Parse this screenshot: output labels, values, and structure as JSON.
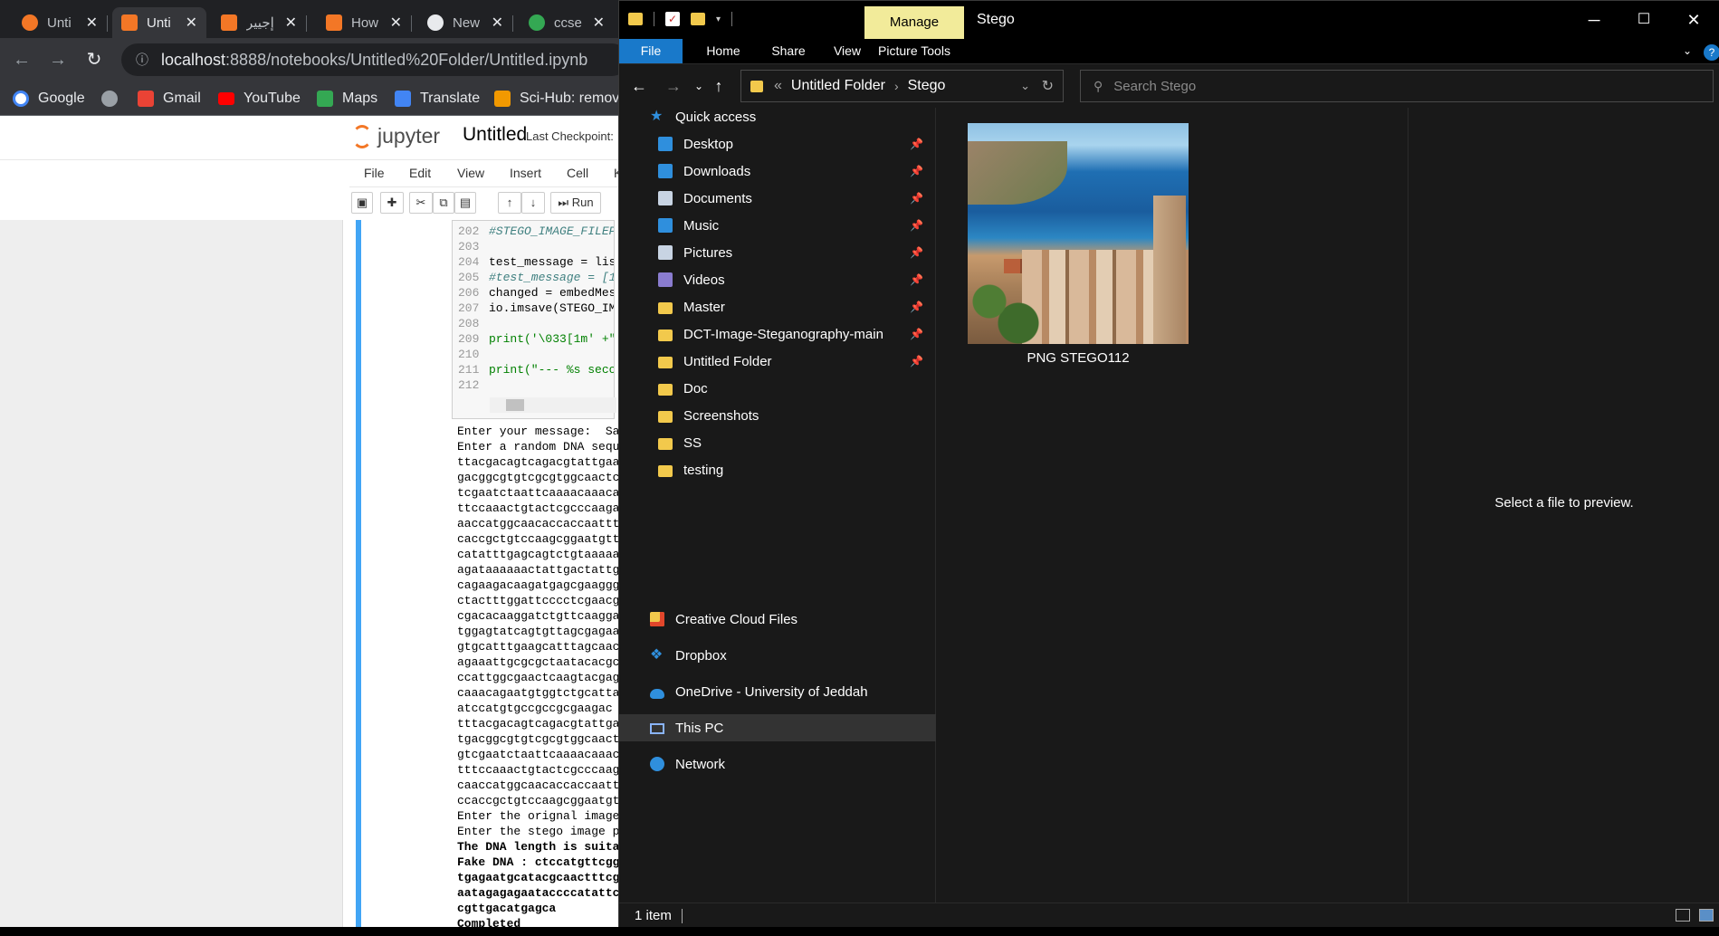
{
  "browser": {
    "tabs": [
      {
        "label": "Unti",
        "color": "#f37726"
      },
      {
        "label": "Unti",
        "color": "#f37726"
      },
      {
        "label": "إجيير",
        "color": "#f37726"
      },
      {
        "label": "How",
        "color": "#f37726"
      },
      {
        "label": "New",
        "color": "#e8eaed"
      },
      {
        "label": "ccse",
        "color": "#34a853"
      }
    ],
    "url_host": "localhost",
    "url_rest": ":8888/notebooks/Untitled%20Folder/Untitled.ipynb",
    "bookmarks": [
      {
        "label": "Google",
        "color": "#4285f4"
      },
      {
        "label": "",
        "color": "#9aa0a6"
      },
      {
        "label": "Gmail",
        "color": "#ea4335"
      },
      {
        "label": "YouTube",
        "color": "#ff0000"
      },
      {
        "label": "Maps",
        "color": "#34a853"
      },
      {
        "label": "Translate",
        "color": "#4285f4"
      },
      {
        "label": "Sci-Hub: removin",
        "color": "#f29900"
      }
    ]
  },
  "jupyter": {
    "logo": "jupyter",
    "title": "Untitled",
    "checkpoint": "Last Checkpoint: ",
    "menu": [
      "File",
      "Edit",
      "View",
      "Insert",
      "Cell",
      "K"
    ],
    "run_label": "Run",
    "code_lines": [
      {
        "n": "202",
        "text": "#STEGO_IMAGE_FILEPA",
        "style": "cm"
      },
      {
        "n": "203",
        "text": "",
        "style": ""
      },
      {
        "n": "204",
        "text": "test_message = lis",
        "style": ""
      },
      {
        "n": "205",
        "text": "#test_message = [1",
        "style": "cm"
      },
      {
        "n": "206",
        "text": "changed = embedMes",
        "style": ""
      },
      {
        "n": "207",
        "text": "io.imsave(STEGO_IM",
        "style": ""
      },
      {
        "n": "208",
        "text": "",
        "style": ""
      },
      {
        "n": "209",
        "text": "print('\\033[1m' +\"",
        "style": "kw"
      },
      {
        "n": "210",
        "text": "",
        "style": ""
      },
      {
        "n": "211",
        "text": "print(\"--- %s seco",
        "style": "kw"
      },
      {
        "n": "212",
        "text": "",
        "style": ""
      }
    ],
    "output_lines": [
      {
        "text": "Enter your message:  Sa",
        "bold": false
      },
      {
        "text": "Enter a random DNA sequ",
        "bold": false
      },
      {
        "text": "ttacgacagtcagacgtattgaa",
        "bold": false
      },
      {
        "text": "gacggcgtgtcgcgtggcaactc",
        "bold": false
      },
      {
        "text": "tcgaatctaattcaaaacaaaca",
        "bold": false
      },
      {
        "text": "ttccaaactgtactcgcccaaga",
        "bold": false
      },
      {
        "text": "aaccatggcaacaccaccaattt",
        "bold": false
      },
      {
        "text": "caccgctgtccaagcggaatgtt",
        "bold": false
      },
      {
        "text": "catatttgagcagtctgtaaaaa",
        "bold": false
      },
      {
        "text": "agataaaaaactattgactattg",
        "bold": false
      },
      {
        "text": "cagaagacaagatgagcgaaggg",
        "bold": false
      },
      {
        "text": "ctactttggattcccctcgaacg",
        "bold": false
      },
      {
        "text": "cgacacaaggatctgttcaagga",
        "bold": false
      },
      {
        "text": "tggagtatcagtgttagcgagaa",
        "bold": false
      },
      {
        "text": "gtgcatttgaagcatttagcaac",
        "bold": false
      },
      {
        "text": "agaaattgcgcgctaatacacgc",
        "bold": false
      },
      {
        "text": "ccattggcgaactcaagtacgag",
        "bold": false
      },
      {
        "text": "caaacagaatgtggtctgcatta",
        "bold": false
      },
      {
        "text": "atccatgtgccgccgcgaagac",
        "bold": false
      },
      {
        "text": "tttacgacagtcagacgtattga",
        "bold": false
      },
      {
        "text": "tgacggcgtgtcgcgtggcaact",
        "bold": false
      },
      {
        "text": "gtcgaatctaattcaaaacaaac",
        "bold": false
      },
      {
        "text": "tttccaaactgtactcgcccaag",
        "bold": false
      },
      {
        "text": "caaccatggcaacaccaccaatt",
        "bold": false
      },
      {
        "text": "ccaccgctgtccaagcggaatgt",
        "bold": false
      },
      {
        "text": "Enter the orignal image",
        "bold": false
      },
      {
        "text": "Enter the stego image p",
        "bold": false
      },
      {
        "text": "The DNA length is suita",
        "bold": true
      },
      {
        "text": "Fake DNA : ctccatgttcgg",
        "bold": true
      },
      {
        "text": "tgagaatgcatacgcaactttcg",
        "bold": true
      },
      {
        "text": "aatagagagaataccccatattc",
        "bold": true
      },
      {
        "text": "cgttgacatgagca",
        "bold": true
      },
      {
        "text": "Completed",
        "bold": true
      }
    ]
  },
  "explorer": {
    "window_title": "Stego",
    "manage_label": "Manage",
    "ribbon_tabs": [
      "File",
      "Home",
      "Share",
      "View",
      "Picture Tools"
    ],
    "breadcrumb": [
      "Untitled Folder",
      "Stego"
    ],
    "breadcrumb_prefix": "«",
    "search_placeholder": "Search Stego",
    "nav": {
      "quick_access": "Quick access",
      "pinned": [
        {
          "label": "Desktop",
          "icon": "desktop-icon",
          "color": "#2f8fdd"
        },
        {
          "label": "Downloads",
          "icon": "downloads-icon",
          "color": "#2f8fdd"
        },
        {
          "label": "Documents",
          "icon": "documents-icon",
          "color": "#c8d4e3"
        },
        {
          "label": "Music",
          "icon": "music-icon",
          "color": "#2f8fdd"
        },
        {
          "label": "Pictures",
          "icon": "pictures-icon",
          "color": "#c8d4e3"
        },
        {
          "label": "Videos",
          "icon": "videos-icon",
          "color": "#8a7ccf"
        },
        {
          "label": "Master",
          "icon": "folder-icon",
          "color": "#f2c94c"
        },
        {
          "label": "DCT-Image-Steganography-main",
          "icon": "folder-icon",
          "color": "#f2c94c"
        },
        {
          "label": "Untitled Folder",
          "icon": "folder-icon",
          "color": "#f2c94c"
        }
      ],
      "recent": [
        {
          "label": "Doc"
        },
        {
          "label": "Screenshots"
        },
        {
          "label": "SS"
        },
        {
          "label": "testing"
        }
      ],
      "creative_cloud": "Creative Cloud Files",
      "dropbox": "Dropbox",
      "onedrive": "OneDrive - University of Jeddah",
      "this_pc": "This PC",
      "network": "Network"
    },
    "file": {
      "name": "PNG STEGO112"
    },
    "preview_text": "Select a file to preview.",
    "status": "1 item"
  }
}
